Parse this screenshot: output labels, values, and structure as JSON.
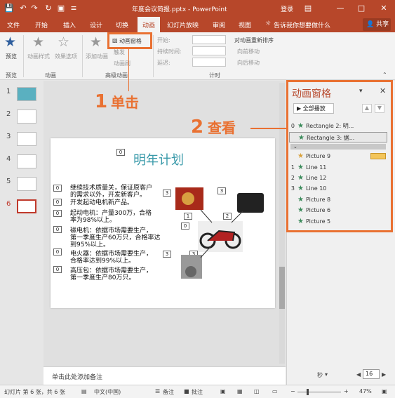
{
  "titlebar": {
    "title": "年度会议简报.pptx - PowerPoint",
    "login": "登录"
  },
  "tabs": [
    "文件",
    "开始",
    "插入",
    "设计",
    "切换",
    "动画",
    "幻灯片放映",
    "审阅",
    "视图"
  ],
  "active_tab": "动画",
  "tell_me": "告诉我你想要做什么",
  "share": "共享",
  "ribbon": {
    "preview": "预览",
    "anim_style": "动画样式",
    "effect_options": "效果选项",
    "add_anim": "添加动画",
    "anim_pane": "动画窗格",
    "trigger": "触发",
    "anim_brush": "动画刷",
    "start": "开始:",
    "duration": "持续时间:",
    "delay": "延迟:",
    "reorder": "对动画重新排序",
    "move_earlier": "向前移动",
    "move_later": "向后移动",
    "groups": {
      "preview": "预览",
      "animation": "动画",
      "advanced": "高级动画",
      "timing": "计时"
    }
  },
  "slides": [
    "1",
    "2",
    "3",
    "4",
    "5",
    "6"
  ],
  "active_slide": "6",
  "slide": {
    "title": "明年计划",
    "lines": [
      "继续技术质量关，保证原客户",
      "的需求以外，开发新客户。",
      "开发起动电机新产品。",
      "起动电机：产量300万，合格",
      "率为98%以上。",
      "磁电机：依据市场需要生产，",
      "第一季度生产60万只，合格率达",
      "到95%以上。",
      "电火器：依据市场需要生产，",
      "合格率达到99%以上。",
      "高压包：依据市场需要生产，",
      "第一季度生产80万只。"
    ],
    "badges": [
      "0",
      "0",
      "0",
      "0",
      "0",
      "0",
      "0",
      "3",
      "3",
      "2",
      "1",
      "0",
      "3",
      "3"
    ]
  },
  "notes_placeholder": "单击此处添加备注",
  "pane": {
    "title": "动画窗格",
    "play_all": "全部播放",
    "items": [
      {
        "num": "0",
        "label": "Rectangle 2: 明...",
        "color": "#3a8a5a"
      },
      {
        "num": "",
        "label": "Rectangle 3: 据...",
        "color": "#3a8a5a"
      },
      {
        "num": "",
        "label": "Picture 9",
        "color": "#d9a13b"
      },
      {
        "num": "1",
        "label": "Line 11",
        "color": "#3a8a5a"
      },
      {
        "num": "2",
        "label": "Line 12",
        "color": "#3a8a5a"
      },
      {
        "num": "3",
        "label": "Line 10",
        "color": "#3a8a5a"
      },
      {
        "num": "",
        "label": "Picture 8",
        "color": "#3a8a5a"
      },
      {
        "num": "",
        "label": "Picture 6",
        "color": "#3a8a5a"
      },
      {
        "num": "",
        "label": "Picture 5",
        "color": "#3a8a5a"
      }
    ],
    "seconds": "秒",
    "time_value": "16"
  },
  "status": {
    "slide_info": "幻灯片 第 6 张，共 6 张",
    "language": "中文(中国)",
    "notes": "备注",
    "comments": "批注",
    "zoom": "47%"
  },
  "annotations": {
    "step1_num": "1",
    "step1_text": "单击",
    "step2_num": "2",
    "step2_text": "查看",
    "color": "#e97132"
  }
}
